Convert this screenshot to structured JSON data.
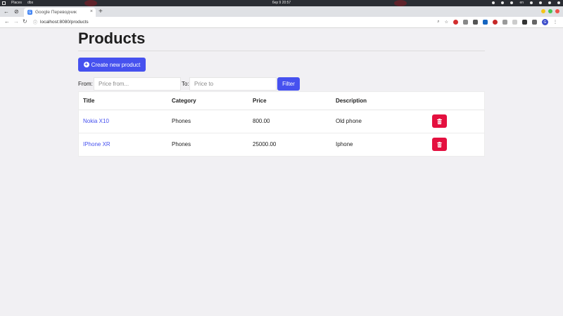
{
  "os_bar": {
    "places_label": "Places",
    "app_label": "dbs",
    "datetime": "бер 9  20:57",
    "lang": "en"
  },
  "browser": {
    "tab_title": "Google Переводчик",
    "url": "localhost:8080/products"
  },
  "page": {
    "title": "Products",
    "create_button_label": "Create new product",
    "filter": {
      "from_label": "From:",
      "from_placeholder": "Price from...",
      "to_label": "To:",
      "to_placeholder": "Price to",
      "button_label": "Filter"
    },
    "table": {
      "headers": [
        "Title",
        "Category",
        "Price",
        "Description"
      ],
      "rows": [
        {
          "title": "Nokia X10",
          "category": "Phones",
          "price": "800.00",
          "description": "Old phone"
        },
        {
          "title": "IPhone XR",
          "category": "Phones",
          "price": "25000.00",
          "description": "Iphone"
        }
      ]
    }
  },
  "icons": {
    "create": "plus-circle-icon",
    "delete": "trash-icon"
  },
  "colors": {
    "primary": "#4651ef",
    "danger": "#e4103f",
    "background": "#f1f0f3"
  }
}
